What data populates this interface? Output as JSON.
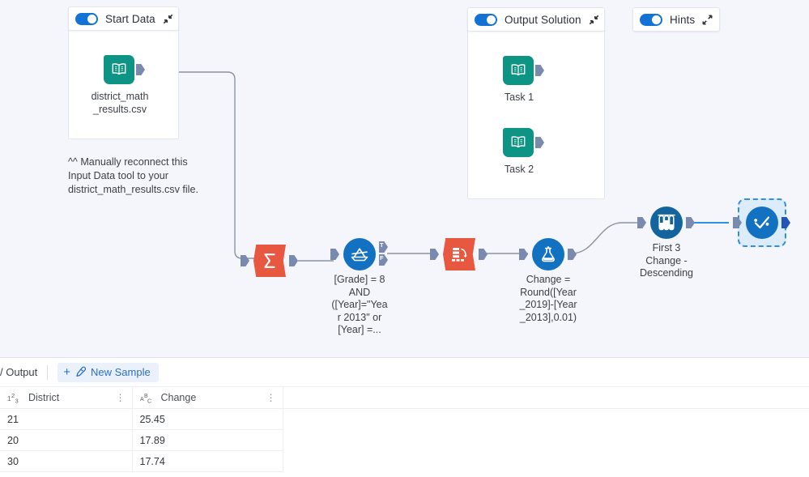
{
  "canvas": {
    "background_color": "#f4f6fb",
    "containers": [
      {
        "id": "start-data",
        "title": "Start Data",
        "toggle_on": true,
        "zoom_icon": "collapse-icon",
        "tools": [
          {
            "id": "input-data",
            "icon": "input-data-icon",
            "label": "district_math\n_results.csv"
          }
        ]
      },
      {
        "id": "output-solution",
        "title": "Output Solution",
        "toggle_on": true,
        "zoom_icon": "collapse-icon",
        "tools": [
          {
            "id": "task-1",
            "icon": "input-data-icon",
            "label": "Task 1"
          },
          {
            "id": "task-2",
            "icon": "input-data-icon",
            "label": "Task 2"
          }
        ]
      },
      {
        "id": "hints",
        "title": "Hints",
        "toggle_on": true,
        "zoom_icon": "expand-icon",
        "tools": []
      }
    ],
    "note": "^^ Manually reconnect this\nInput Data tool to your\ndistrict_math_results.csv file.",
    "tools": [
      {
        "id": "summarize",
        "icon": "summarize-icon",
        "label": "",
        "color": "#e8573f"
      },
      {
        "id": "filter",
        "icon": "filter-icon",
        "label": "[Grade] = 8\nAND\n([Year]=\"Yea\nr 2013\" or\n[Year] =...",
        "color": "#1271c0",
        "anchors": [
          "T",
          "F"
        ]
      },
      {
        "id": "crosstab",
        "icon": "crosstab-icon",
        "label": "",
        "color": "#e8573f"
      },
      {
        "id": "formula",
        "icon": "formula-icon",
        "label": "Change =\nRound([Year\n_2019]-[Year\n_2013],0.01)",
        "color": "#1271c0"
      },
      {
        "id": "sample",
        "icon": "sample-icon",
        "label": "First 3\nChange -\nDescending",
        "color": "#13639e"
      },
      {
        "id": "browse",
        "icon": "browse-icon",
        "label": "",
        "color": "#1271c0",
        "selected": true
      }
    ]
  },
  "results": {
    "breadcrumb": "/ Output",
    "new_sample_label": "New Sample",
    "new_sample_plus": "+",
    "new_sample_icon": "pipette-icon",
    "columns": [
      {
        "name": "District",
        "type_icon": "numeric-type-icon",
        "type_glyph": "1²₃"
      },
      {
        "name": "Change",
        "type_icon": "text-type-icon",
        "type_glyph": "Aᴮᴄ"
      }
    ],
    "rows": [
      {
        "District": "21",
        "Change": "25.45"
      },
      {
        "District": "20",
        "Change": "17.89"
      },
      {
        "District": "30",
        "Change": "17.74"
      }
    ]
  },
  "colors": {
    "accent_blue": "#1372d6",
    "tool_blue": "#1271c0",
    "tool_red": "#e8573f",
    "tool_teal": "#0e9484",
    "anchor": "#7a89ae",
    "canvas_bg": "#f4f6fb"
  }
}
